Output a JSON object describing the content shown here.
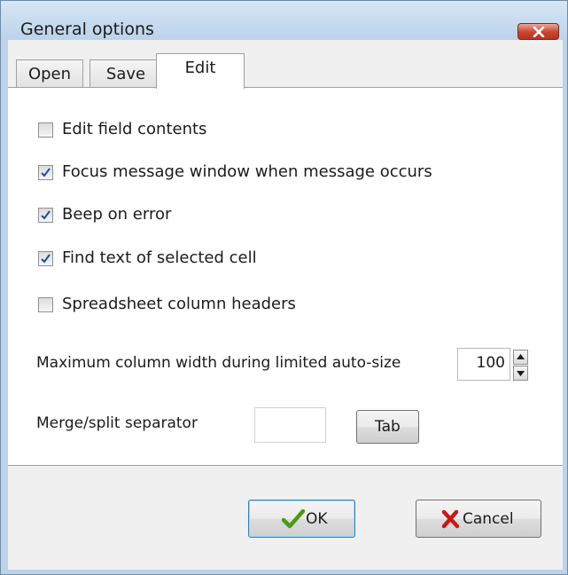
{
  "window": {
    "title": "General options"
  },
  "tabs": [
    {
      "label": "Open",
      "active": false
    },
    {
      "label": "Save",
      "active": false
    },
    {
      "label": "Edit",
      "active": true
    }
  ],
  "edit_tab": {
    "checkboxes": [
      {
        "label": "Edit field contents",
        "checked": false
      },
      {
        "label": "Focus message window when message occurs",
        "checked": true
      },
      {
        "label": "Beep on error",
        "checked": true
      },
      {
        "label": "Find text of selected cell",
        "checked": true
      },
      {
        "label": "Spreadsheet column headers",
        "checked": false
      }
    ],
    "max_width_label": "Maximum column width during limited auto-size",
    "max_width_value": "100",
    "separator_label": "Merge/split separator",
    "separator_value": "",
    "tab_button_label": "Tab"
  },
  "buttons": {
    "ok_label": "OK",
    "cancel_label": "Cancel"
  },
  "colors": {
    "check": "#1c4ea0",
    "ok_icon": "#4a9a16",
    "cancel_icon": "#c81818",
    "close": "#c9442f"
  }
}
